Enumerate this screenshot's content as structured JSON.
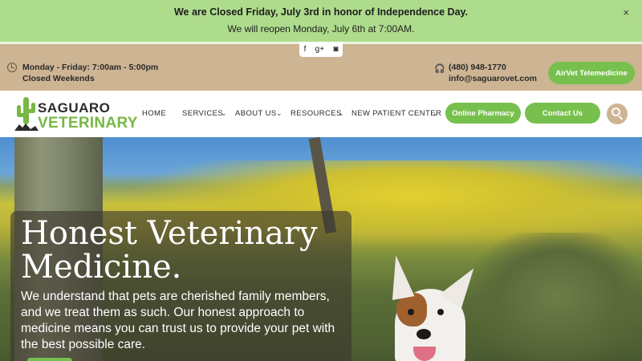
{
  "announcement": {
    "headline": "We are Closed Friday, July 3rd in honor of Independence Day.",
    "subline": "We will reopen Monday, July 6th at 7:00AM.",
    "close_glyph": "×"
  },
  "social": {
    "facebook": "f",
    "google_plus": "g+",
    "instagram": "◙"
  },
  "info": {
    "hours_line1": "Monday - Friday: 7:00am - 5:00pm",
    "hours_line2": "Closed Weekends",
    "phone": "(480) 948-1770",
    "email": "info@saguarovet.com",
    "airvet_label": "AirVet Telemedicine"
  },
  "logo": {
    "word1": "SAGUARO",
    "word2": "VETERINARY"
  },
  "nav": {
    "items": [
      "HOME",
      "SERVICES",
      "ABOUT US",
      "RESOURCES",
      "NEW PATIENT CENTER"
    ],
    "pharmacy_label": "Online Pharmacy",
    "contact_label": "Contact Us"
  },
  "hero": {
    "heading": "Honest Veterinary Medicine.",
    "body": "We understand that pets are cherished family members, and we treat them as such. Our honest approach to medicine means you can trust us to provide your pet with the best possible care."
  },
  "colors": {
    "green": "#78c04d",
    "tan": "#cdb493",
    "announce": "#aedc8d"
  },
  "icons": [
    "clock-icon",
    "headset-icon",
    "search-icon",
    "close-icon",
    "chevron-down-icon",
    "saguaro-cactus-icon"
  ]
}
